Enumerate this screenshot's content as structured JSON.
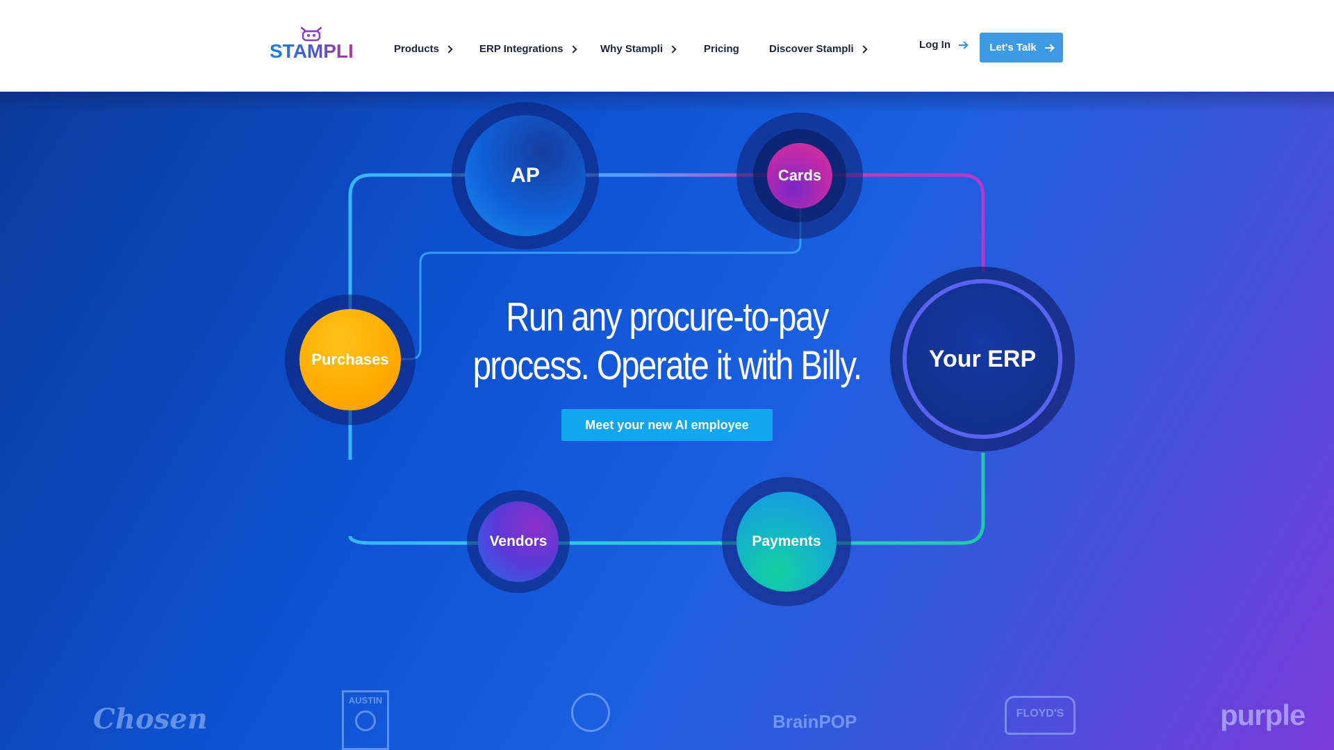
{
  "header": {
    "logo_text": "STAMPLI",
    "nav": [
      {
        "label": "Products",
        "has_submenu": true
      },
      {
        "label": "ERP Integrations",
        "has_submenu": true
      },
      {
        "label": "Why Stampli",
        "has_submenu": true
      },
      {
        "label": "Pricing",
        "has_submenu": false
      },
      {
        "label": "Discover Stampli",
        "has_submenu": true
      }
    ],
    "login_label": "Log In",
    "cta_label": "Let's Talk"
  },
  "hero": {
    "headline_line1": "Run any procure-to-pay",
    "headline_line2": "process. Operate it with Billy.",
    "cta_label": "Meet your new AI employee",
    "nodes": {
      "ap": "AP",
      "cards": "Cards",
      "purchases": "Purchases",
      "erp": "Your ERP",
      "vendors": "Vendors",
      "payments": "Payments"
    }
  },
  "customer_logos": {
    "chosen": "Chosen",
    "austin": "AUSTIN",
    "brainpop": "BrainPOP",
    "floyds": "FLOYD'S",
    "purple": "purple"
  },
  "colors": {
    "brand_blue": "#3d9be5",
    "cta_blue": "#12a6ef",
    "nav_text": "#1b2540",
    "purchases_orange": "#ffa500",
    "cards_magenta": "#c42aa8"
  }
}
